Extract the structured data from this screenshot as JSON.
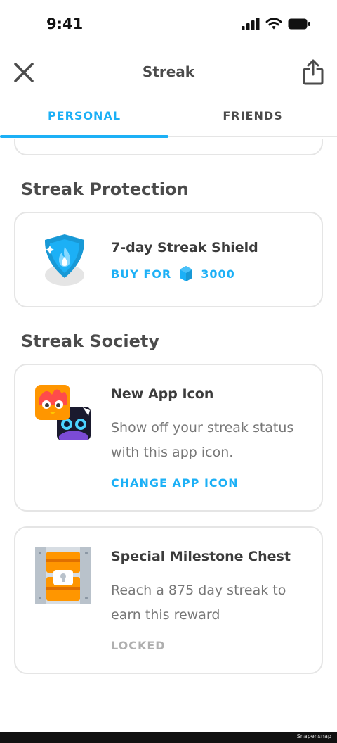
{
  "status_bar": {
    "time": "9:41"
  },
  "header": {
    "title": "Streak"
  },
  "tabs": [
    {
      "label": "PERSONAL",
      "active": true
    },
    {
      "label": "FRIENDS",
      "active": false
    }
  ],
  "sections": {
    "protection": {
      "title": "Streak Protection",
      "item": {
        "title": "7-day Streak Shield",
        "buy_label": "BUY FOR",
        "price": "3000"
      }
    },
    "society": {
      "title": "Streak Society",
      "items": [
        {
          "title": "New App Icon",
          "description": "Show off your streak status with this app icon.",
          "action": "CHANGE APP ICON"
        },
        {
          "title": "Special Milestone Chest",
          "description": "Reach a 875 day streak to earn this reward",
          "status": "LOCKED"
        }
      ]
    }
  },
  "watermark": "Snapensnap",
  "colors": {
    "accent": "#1cb0f6",
    "text": "#3c3c3c",
    "muted": "#777777",
    "border": "#e5e5e5",
    "locked": "#afafaf"
  }
}
